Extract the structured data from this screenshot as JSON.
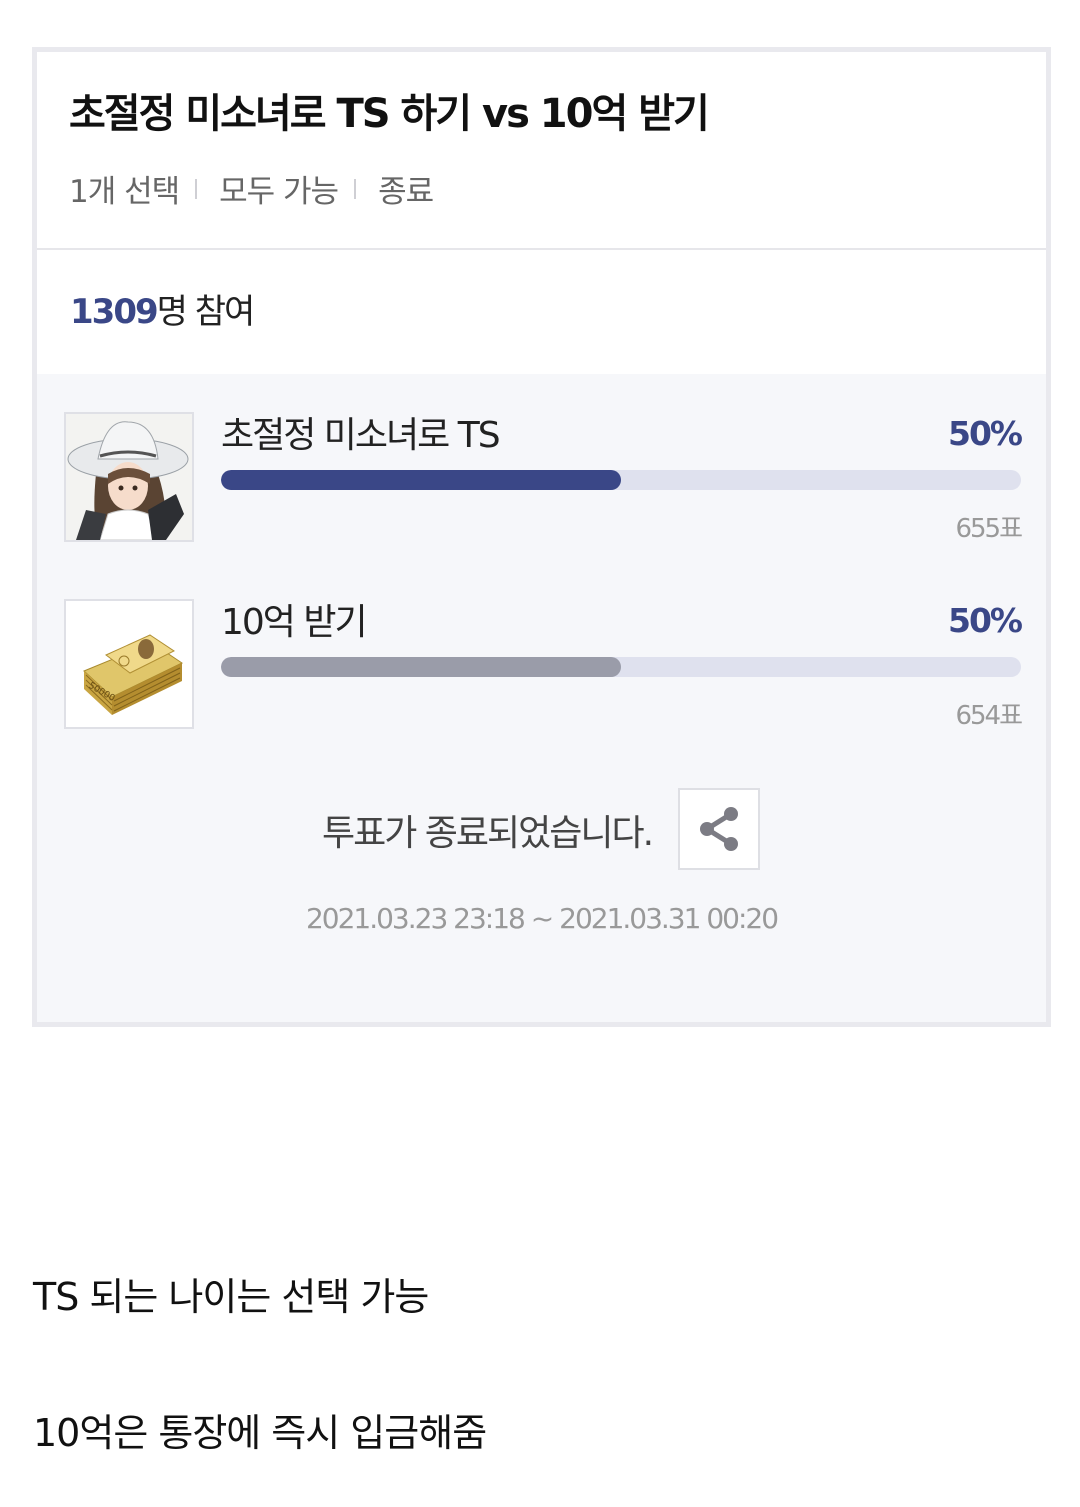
{
  "poll": {
    "title": "초절정 미소녀로 TS 하기 vs 10억 받기",
    "meta": [
      "1개 선택",
      "모두 가능",
      "종료"
    ],
    "participants_count": "1309",
    "participants_suffix": "명 참여",
    "options": [
      {
        "label": "초절정 미소녀로 TS",
        "percent": "50%",
        "votes": "655표",
        "fill_fraction": 0.5,
        "bar_color": "#3a4787",
        "image": "anime-girl-with-hat"
      },
      {
        "label": "10억 받기",
        "percent": "50%",
        "votes": "654표",
        "fill_fraction": 0.5,
        "bar_color": "#9a9ca9",
        "image": "stack-of-50000-won-bills"
      }
    ],
    "ended_text": "투표가 종료되었습니다.",
    "share_icon": "share-icon",
    "period": "2021.03.23 23:18 ~ 2021.03.31 00:20"
  },
  "post": {
    "line1": "TS 되는 나이는 선택 가능",
    "line2": "10억은 통장에 즉시 입금해줌"
  }
}
